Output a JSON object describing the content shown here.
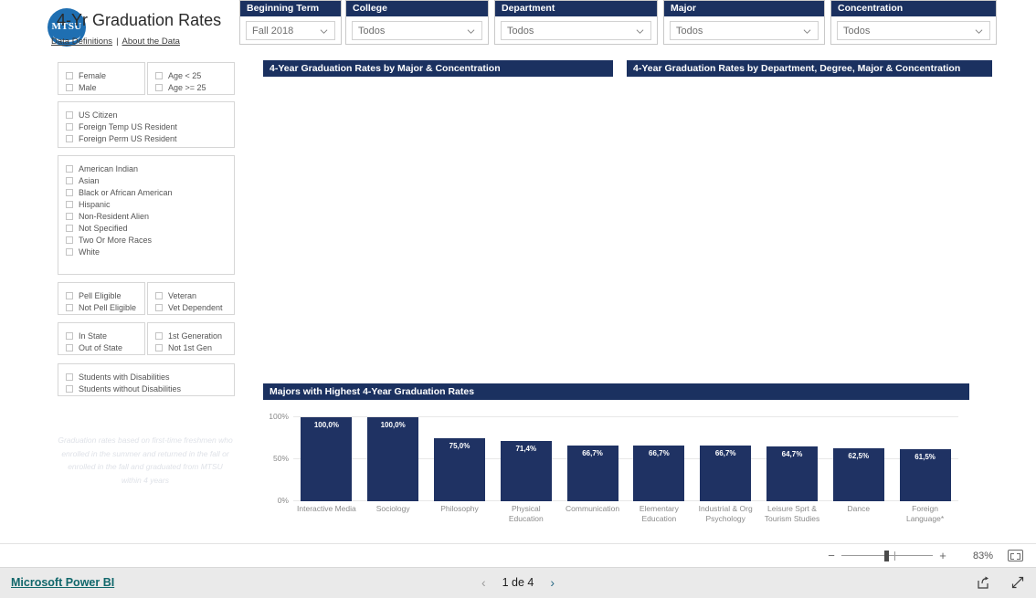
{
  "header": {
    "logo_text": "MTSU",
    "title": "4-Yr Graduation Rates",
    "link_data_definitions": "Data Definitions",
    "link_separator": "|",
    "link_about": "About the Data"
  },
  "top_slicers": [
    {
      "name": "beginning-term",
      "label": "Beginning Term",
      "value": "Fall 2018"
    },
    {
      "name": "college",
      "label": "College",
      "value": "Todos"
    },
    {
      "name": "department",
      "label": "Department",
      "value": "Todos"
    },
    {
      "name": "major",
      "label": "Major",
      "value": "Todos"
    },
    {
      "name": "concentration",
      "label": "Concentration",
      "value": "Todos"
    }
  ],
  "sidebar": {
    "groups": [
      {
        "name": "gender",
        "items": [
          "Female",
          "Male"
        ]
      },
      {
        "name": "age",
        "items": [
          "Age < 25",
          "Age >= 25"
        ]
      },
      {
        "name": "residency",
        "items": [
          "US Citizen",
          "Foreign Temp US Resident",
          "Foreign Perm US Resident"
        ]
      },
      {
        "name": "ethnicity",
        "items": [
          "American Indian",
          "Asian",
          "Black or African American",
          "Hispanic",
          "Non-Resident Alien",
          "Not Specified",
          "Two Or More Races",
          "White"
        ]
      },
      {
        "name": "pell",
        "items": [
          "Pell Eligible",
          "Not Pell Eligible"
        ]
      },
      {
        "name": "veteran",
        "items": [
          "Veteran",
          "Vet Dependent"
        ]
      },
      {
        "name": "state",
        "items": [
          "In State",
          "Out of State"
        ]
      },
      {
        "name": "generation",
        "items": [
          "1st Generation",
          "Not 1st Gen"
        ]
      },
      {
        "name": "disability",
        "items": [
          "Students with Disabilities",
          "Students without Disabilities"
        ]
      }
    ],
    "footnote": "Graduation rates based on first-time freshmen who enrolled in the summer and returned in the fall or enrolled in the fall and graduated from MTSU within 4 years"
  },
  "visuals": {
    "major_concentration_title": "4-Year Graduation Rates by Major & Concentration",
    "dept_degree_title": "4-Year Graduation Rates by Department, Degree, Major & Concentration"
  },
  "chart_data": {
    "type": "bar",
    "title": "Majors with Highest 4-Year Graduation Rates",
    "xlabel": "",
    "ylabel": "",
    "ylim": [
      0,
      100
    ],
    "yticks": [
      "100%",
      "50%",
      "0%"
    ],
    "ytick_values": [
      100,
      50,
      0
    ],
    "grid": true,
    "legend": "none",
    "bar_color": "#1f3263",
    "categories": [
      "Interactive Media",
      "Sociology",
      "Philosophy",
      "Physical Education",
      "Communication",
      "Elementary Education",
      "Industrial & Org Psychology",
      "Leisure Sprt & Tourism Studies",
      "Dance",
      "Foreign Language*"
    ],
    "values": [
      100.0,
      100.0,
      75.0,
      71.4,
      66.7,
      66.7,
      66.7,
      64.7,
      62.5,
      61.5
    ],
    "value_labels": [
      "100,0%",
      "100,0%",
      "75,0%",
      "71,4%",
      "66,7%",
      "66,7%",
      "66,7%",
      "64,7%",
      "62,5%",
      "61,5%"
    ]
  },
  "zoombar": {
    "minus": "−",
    "plus": "+",
    "percent": "83%"
  },
  "footer": {
    "powerbi_label": "Microsoft Power BI",
    "page_text": "1 de 4",
    "prev_arrow": "‹",
    "next_arrow": "›"
  }
}
